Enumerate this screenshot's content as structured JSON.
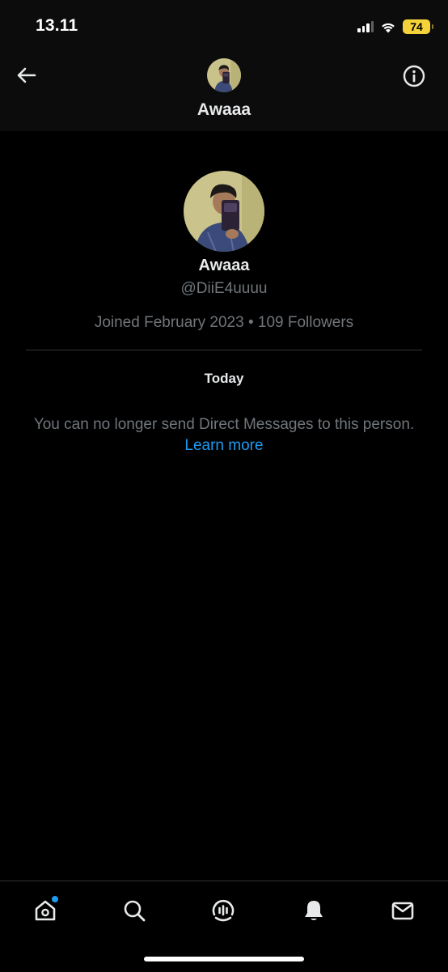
{
  "status_bar": {
    "time": "13.11",
    "battery": "74"
  },
  "header": {
    "title": "Awaaa"
  },
  "profile": {
    "name": "Awaaa",
    "handle": "@DiiE4uuuu",
    "meta": "Joined February 2023 • 109 Followers"
  },
  "conversation": {
    "date_label": "Today",
    "notice": "You can no longer send Direct Messages to this person.",
    "learn_more": "Learn more"
  },
  "nav": {
    "items": [
      "home-icon",
      "search-icon",
      "spaces-icon",
      "notifications-icon",
      "messages-icon"
    ],
    "home_has_dot": true
  },
  "colors": {
    "background": "#000000",
    "primary_text": "#e7e9ea",
    "secondary_text": "#71767b",
    "accent": "#1d9bf0",
    "battery": "#f5d23a"
  }
}
